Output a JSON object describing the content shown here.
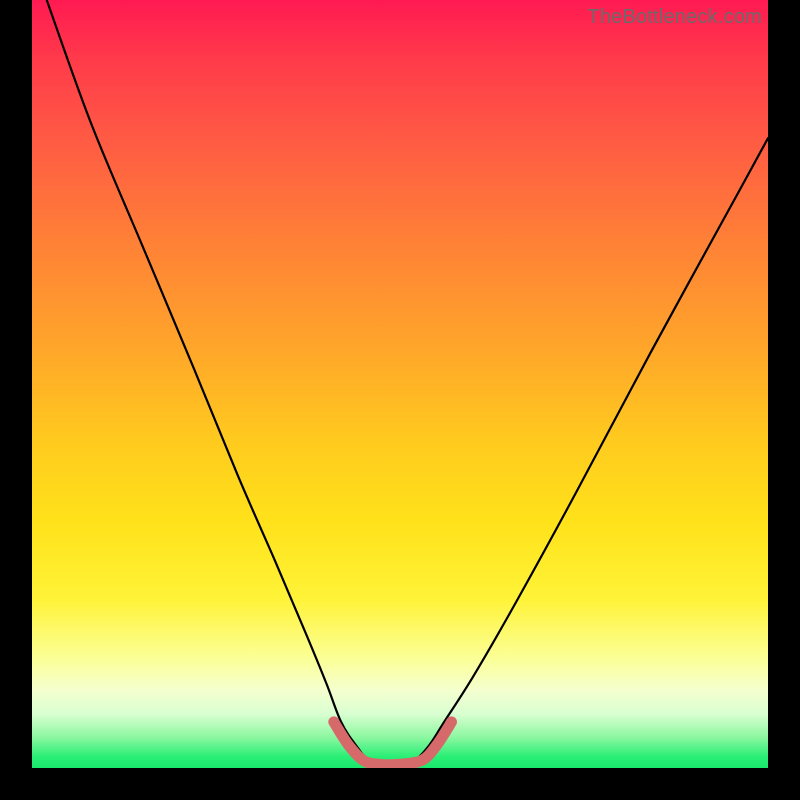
{
  "watermark": {
    "text": "TheBottleneck.com"
  },
  "colors": {
    "frame": "#000000",
    "curve_stroke": "#000000",
    "valley_stroke": "#d66a6a",
    "gradient_top": "#ff1a52",
    "gradient_bottom": "#18e86c"
  },
  "chart_data": {
    "type": "line",
    "title": "",
    "xlabel": "",
    "ylabel": "",
    "xlim": [
      0,
      100
    ],
    "ylim": [
      0,
      100
    ],
    "grid": false,
    "legend": false,
    "annotations": [],
    "series": [
      {
        "name": "curve",
        "x": [
          2,
          8,
          15,
          22,
          28,
          33,
          37,
          40,
          42,
          44,
          46,
          50,
          52,
          54,
          56,
          60,
          66,
          74,
          84,
          96,
          100
        ],
        "y": [
          100,
          84,
          68,
          52,
          38,
          27,
          18,
          11,
          6,
          3,
          1,
          0.5,
          1,
          3,
          6,
          12,
          22,
          36,
          54,
          75,
          82
        ]
      },
      {
        "name": "valley-highlight",
        "x": [
          41,
          43,
          45,
          47,
          50,
          53,
          55,
          57
        ],
        "y": [
          6,
          3,
          1,
          0.5,
          0.5,
          1,
          3,
          6
        ]
      }
    ]
  }
}
